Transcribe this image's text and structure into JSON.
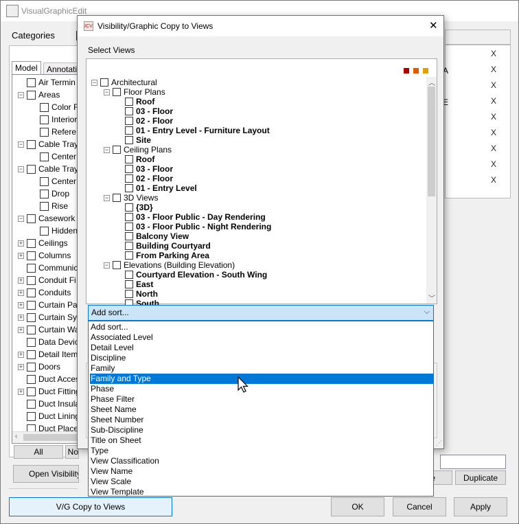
{
  "main_window": {
    "title": "VisualGraphicEdit",
    "categories_label": "Categories",
    "tabs": [
      "Model",
      "Annotatio"
    ],
    "tree": [
      {
        "indent": 0,
        "exp": "",
        "label": "Air Termin"
      },
      {
        "indent": 0,
        "exp": "−",
        "label": "Areas"
      },
      {
        "indent": 1,
        "exp": "",
        "label": "Color F"
      },
      {
        "indent": 1,
        "exp": "",
        "label": "Interior"
      },
      {
        "indent": 1,
        "exp": "",
        "label": "Refere"
      },
      {
        "indent": 0,
        "exp": "−",
        "label": "Cable Tray"
      },
      {
        "indent": 1,
        "exp": "",
        "label": "Center"
      },
      {
        "indent": 0,
        "exp": "−",
        "label": "Cable Tray"
      },
      {
        "indent": 1,
        "exp": "",
        "label": "Center"
      },
      {
        "indent": 1,
        "exp": "",
        "label": "Drop"
      },
      {
        "indent": 1,
        "exp": "",
        "label": "Rise"
      },
      {
        "indent": 0,
        "exp": "−",
        "label": "Casework"
      },
      {
        "indent": 1,
        "exp": "",
        "label": "Hidden"
      },
      {
        "indent": 0,
        "exp": "+",
        "label": "Ceilings"
      },
      {
        "indent": 0,
        "exp": "+",
        "label": "Columns"
      },
      {
        "indent": 0,
        "exp": "",
        "label": "Communic"
      },
      {
        "indent": 0,
        "exp": "+",
        "label": "Conduit Fi"
      },
      {
        "indent": 0,
        "exp": "+",
        "label": "Conduits"
      },
      {
        "indent": 0,
        "exp": "+",
        "label": "Curtain Pa"
      },
      {
        "indent": 0,
        "exp": "+",
        "label": "Curtain Sy"
      },
      {
        "indent": 0,
        "exp": "+",
        "label": "Curtain Wa"
      },
      {
        "indent": 0,
        "exp": "",
        "label": "Data Devic"
      },
      {
        "indent": 0,
        "exp": "+",
        "label": "Detail Item"
      },
      {
        "indent": 0,
        "exp": "+",
        "label": "Doors"
      },
      {
        "indent": 0,
        "exp": "",
        "label": "Duct Acces"
      },
      {
        "indent": 0,
        "exp": "+",
        "label": "Duct Fitting"
      },
      {
        "indent": 0,
        "exp": "",
        "label": "Duct Insula"
      },
      {
        "indent": 0,
        "exp": "",
        "label": "Duct Lining"
      },
      {
        "indent": 0,
        "exp": "",
        "label": "Duct Place"
      }
    ],
    "x_marks": [
      "X",
      "X",
      "X",
      "X",
      "X",
      "X",
      "X",
      "X",
      "X"
    ],
    "right_fragments": [
      "A",
      "E"
    ],
    "all_button": "All",
    "none_button": "No",
    "open_vis_button": "Open Visibility/G",
    "e_fragment": "e",
    "duplicate_button": "Duplicate",
    "vg_copy_button": "V/G Copy to Views",
    "ok_button": "OK",
    "cancel_button": "Cancel",
    "apply_button": "Apply"
  },
  "dialog": {
    "title": "Visibility/Graphic Copy to Views",
    "close": "✕",
    "select_views_label": "Select  Views",
    "color_dots": [
      "#b00000",
      "#e05a00",
      "#e0a000"
    ],
    "views": [
      {
        "level": 0,
        "exp": "−",
        "label": "Architectural",
        "bold": false
      },
      {
        "level": 1,
        "exp": "−",
        "label": "Floor Plans",
        "bold": false
      },
      {
        "level": 2,
        "exp": "",
        "label": "Roof",
        "bold": true
      },
      {
        "level": 2,
        "exp": "",
        "label": "03 - Floor",
        "bold": true
      },
      {
        "level": 2,
        "exp": "",
        "label": "02 - Floor",
        "bold": true
      },
      {
        "level": 2,
        "exp": "",
        "label": "01 - Entry Level - Furniture Layout",
        "bold": true
      },
      {
        "level": 2,
        "exp": "",
        "label": "Site",
        "bold": true
      },
      {
        "level": 1,
        "exp": "−",
        "label": "Ceiling Plans",
        "bold": false
      },
      {
        "level": 2,
        "exp": "",
        "label": "Roof",
        "bold": true
      },
      {
        "level": 2,
        "exp": "",
        "label": "03 - Floor",
        "bold": true
      },
      {
        "level": 2,
        "exp": "",
        "label": "02 - Floor",
        "bold": true
      },
      {
        "level": 2,
        "exp": "",
        "label": "01 - Entry Level",
        "bold": true
      },
      {
        "level": 1,
        "exp": "−",
        "label": "3D Views",
        "bold": false
      },
      {
        "level": 2,
        "exp": "",
        "label": "{3D}",
        "bold": true
      },
      {
        "level": 2,
        "exp": "",
        "label": "03 - Floor Public - Day Rendering",
        "bold": true
      },
      {
        "level": 2,
        "exp": "",
        "label": "03 - Floor Public - Night Rendering",
        "bold": true
      },
      {
        "level": 2,
        "exp": "",
        "label": "Balcony View",
        "bold": true
      },
      {
        "level": 2,
        "exp": "",
        "label": "Building Courtyard",
        "bold": true
      },
      {
        "level": 2,
        "exp": "",
        "label": "From Parking Area",
        "bold": true
      },
      {
        "level": 1,
        "exp": "−",
        "label": "Elevations (Building Elevation)",
        "bold": false
      },
      {
        "level": 2,
        "exp": "",
        "label": "Courtyard Elevation - South Wing",
        "bold": true
      },
      {
        "level": 2,
        "exp": "",
        "label": "East",
        "bold": true
      },
      {
        "level": 2,
        "exp": "",
        "label": "North",
        "bold": true
      },
      {
        "level": 2,
        "exp": "",
        "label": "South",
        "bold": true
      }
    ],
    "sort_selected": "Add sort...",
    "sort_options": [
      "Add sort...",
      "Associated Level",
      "Detail Level",
      "Discipline",
      "Family",
      "Family and Type",
      "Phase",
      "Phase Filter",
      "Sheet Name",
      "Sheet Number",
      "Sub-Discipline",
      "Title on Sheet",
      "Type",
      "View Classification",
      "View Name",
      "View Scale",
      "View Template"
    ],
    "sort_highlight": "Family and Type"
  }
}
